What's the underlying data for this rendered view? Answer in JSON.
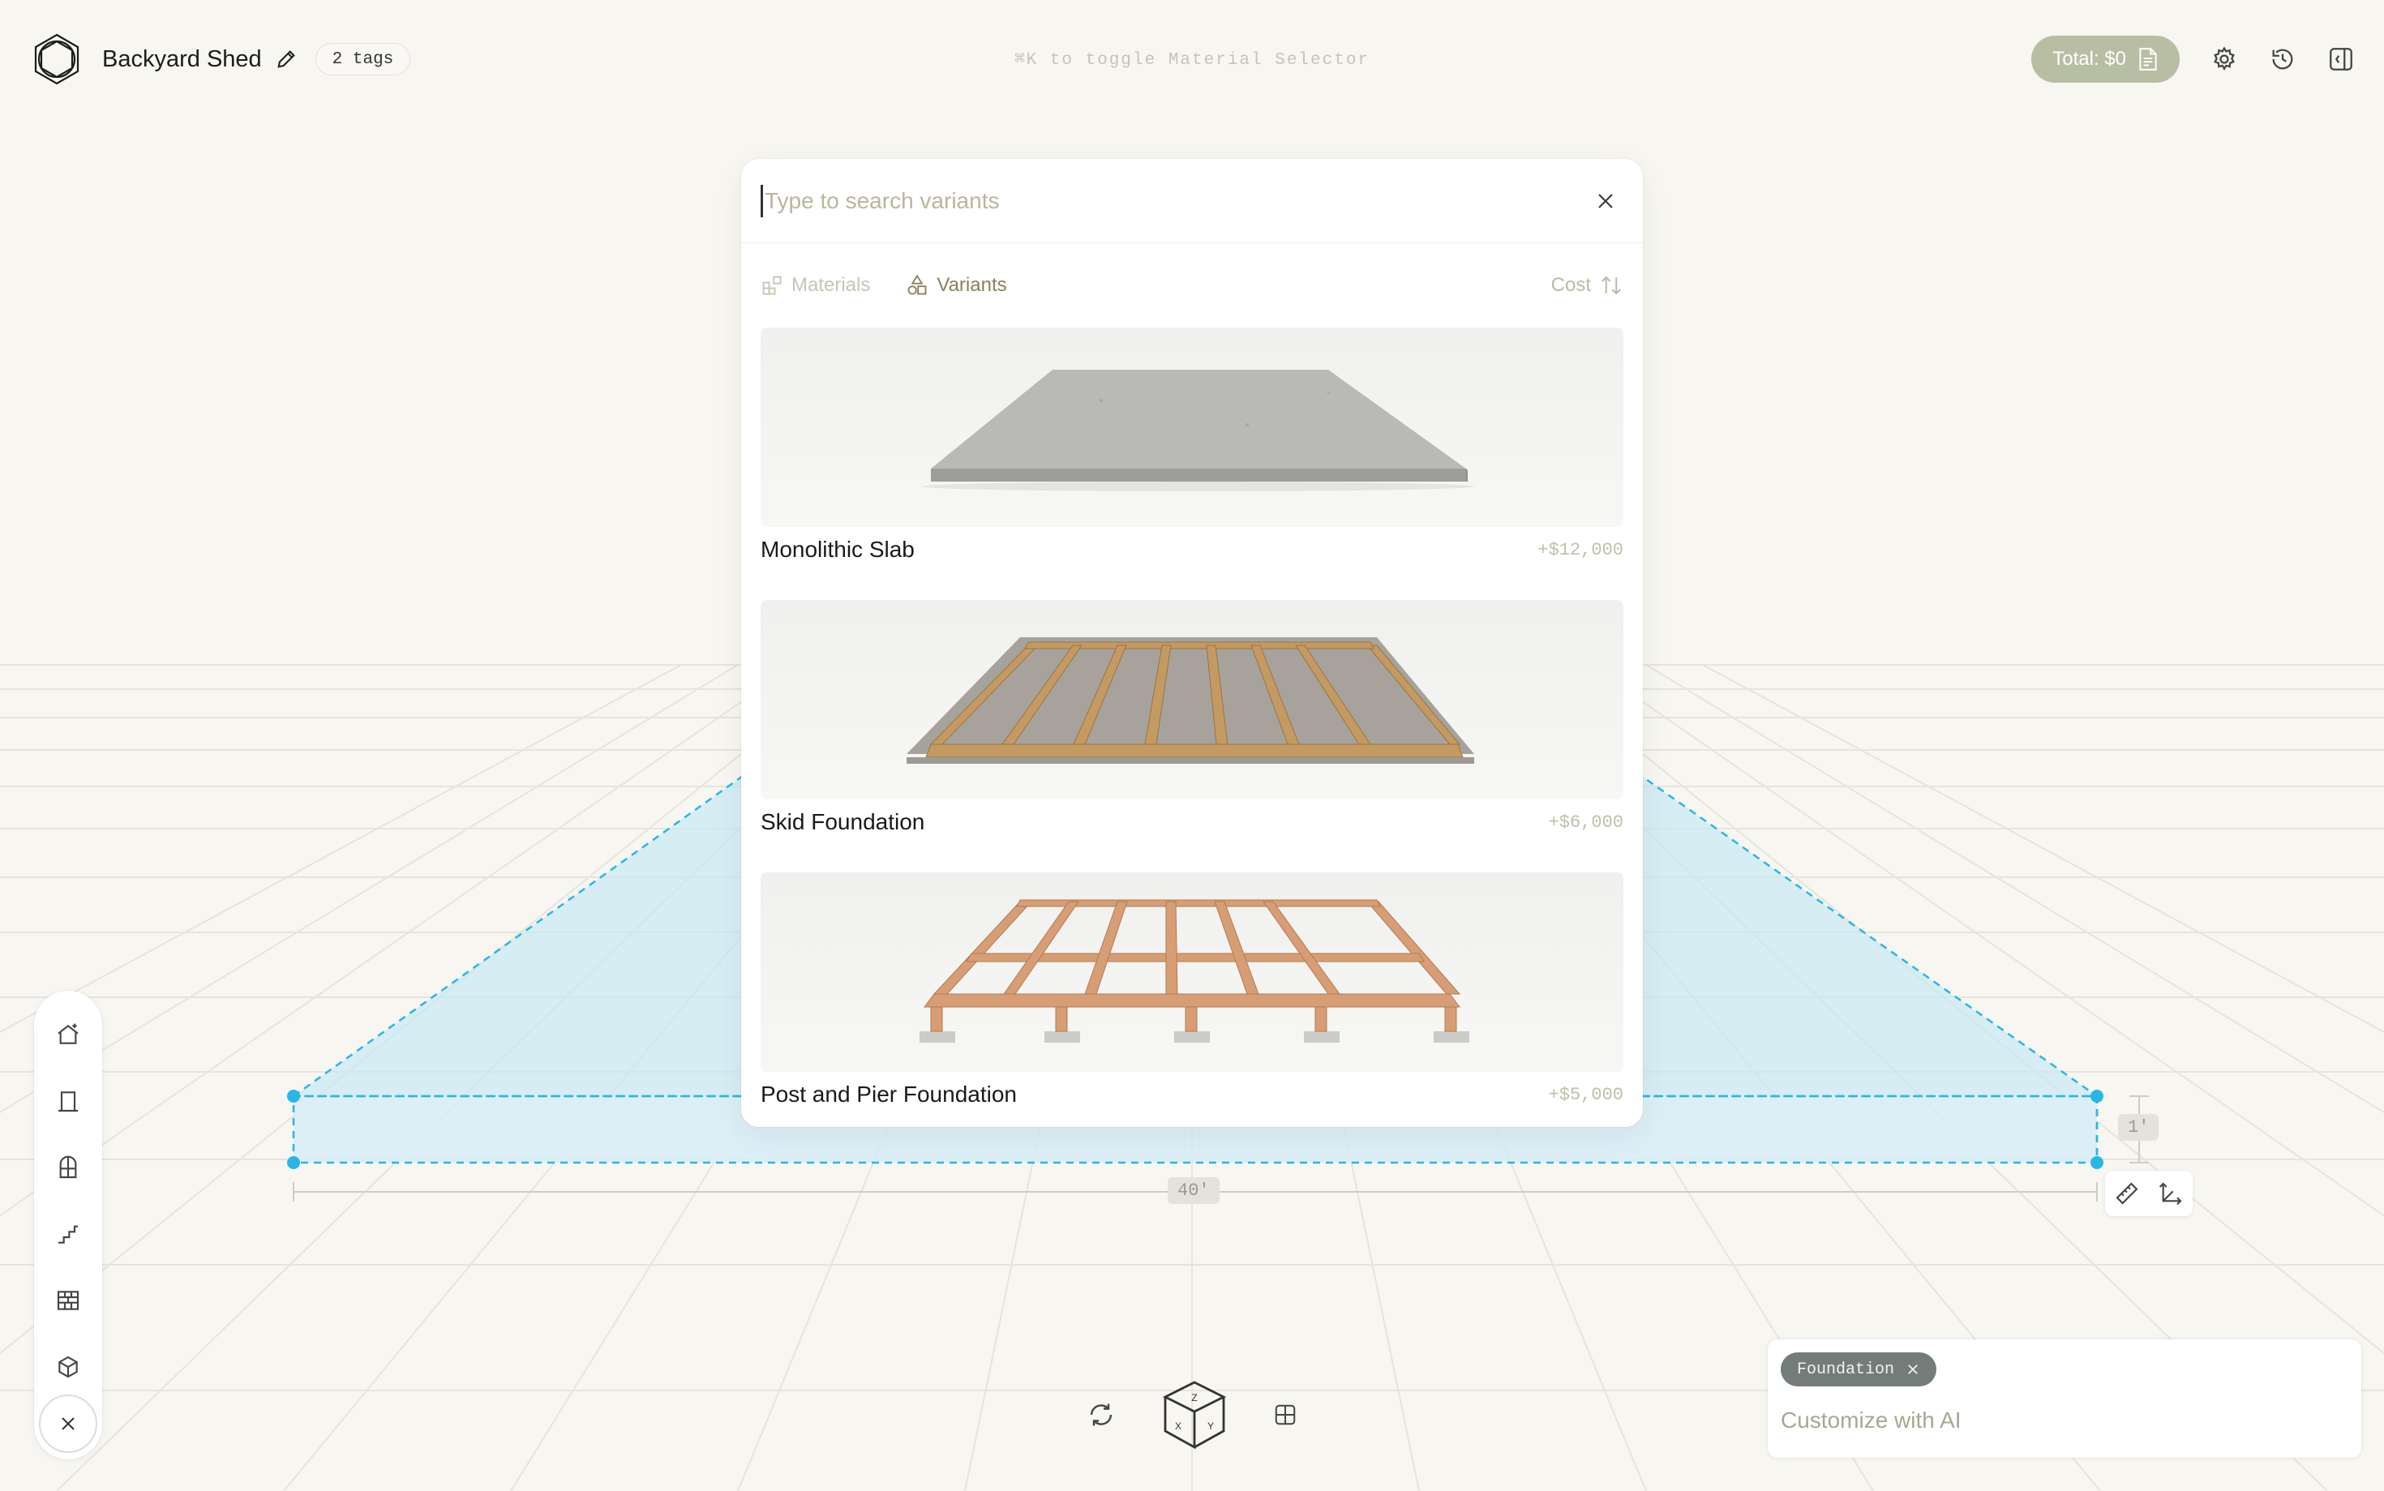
{
  "header": {
    "project_title": "Backyard Shed",
    "tags_label": "2 tags",
    "hint": "⌘K to toggle Material Selector",
    "total_label": "Total: $0"
  },
  "search": {
    "placeholder": "Type to search variants"
  },
  "tabs": [
    {
      "label": "Materials",
      "active": false
    },
    {
      "label": "Variants",
      "active": true
    }
  ],
  "sort": {
    "label": "Cost"
  },
  "variants": [
    {
      "name": "Monolithic Slab",
      "cost": "+$12,000"
    },
    {
      "name": "Skid Foundation",
      "cost": "+$6,000"
    },
    {
      "name": "Post and Pier Foundation",
      "cost": "+$5,000"
    }
  ],
  "dimensions": {
    "width": "40′",
    "height": "1′"
  },
  "ai_panel": {
    "chip_label": "Foundation",
    "placeholder": "Customize with AI"
  },
  "colors": {
    "background": "#f7f6f1",
    "accent": "#b8bea4",
    "selection": "#29b6e6",
    "chip": "#737c78"
  }
}
